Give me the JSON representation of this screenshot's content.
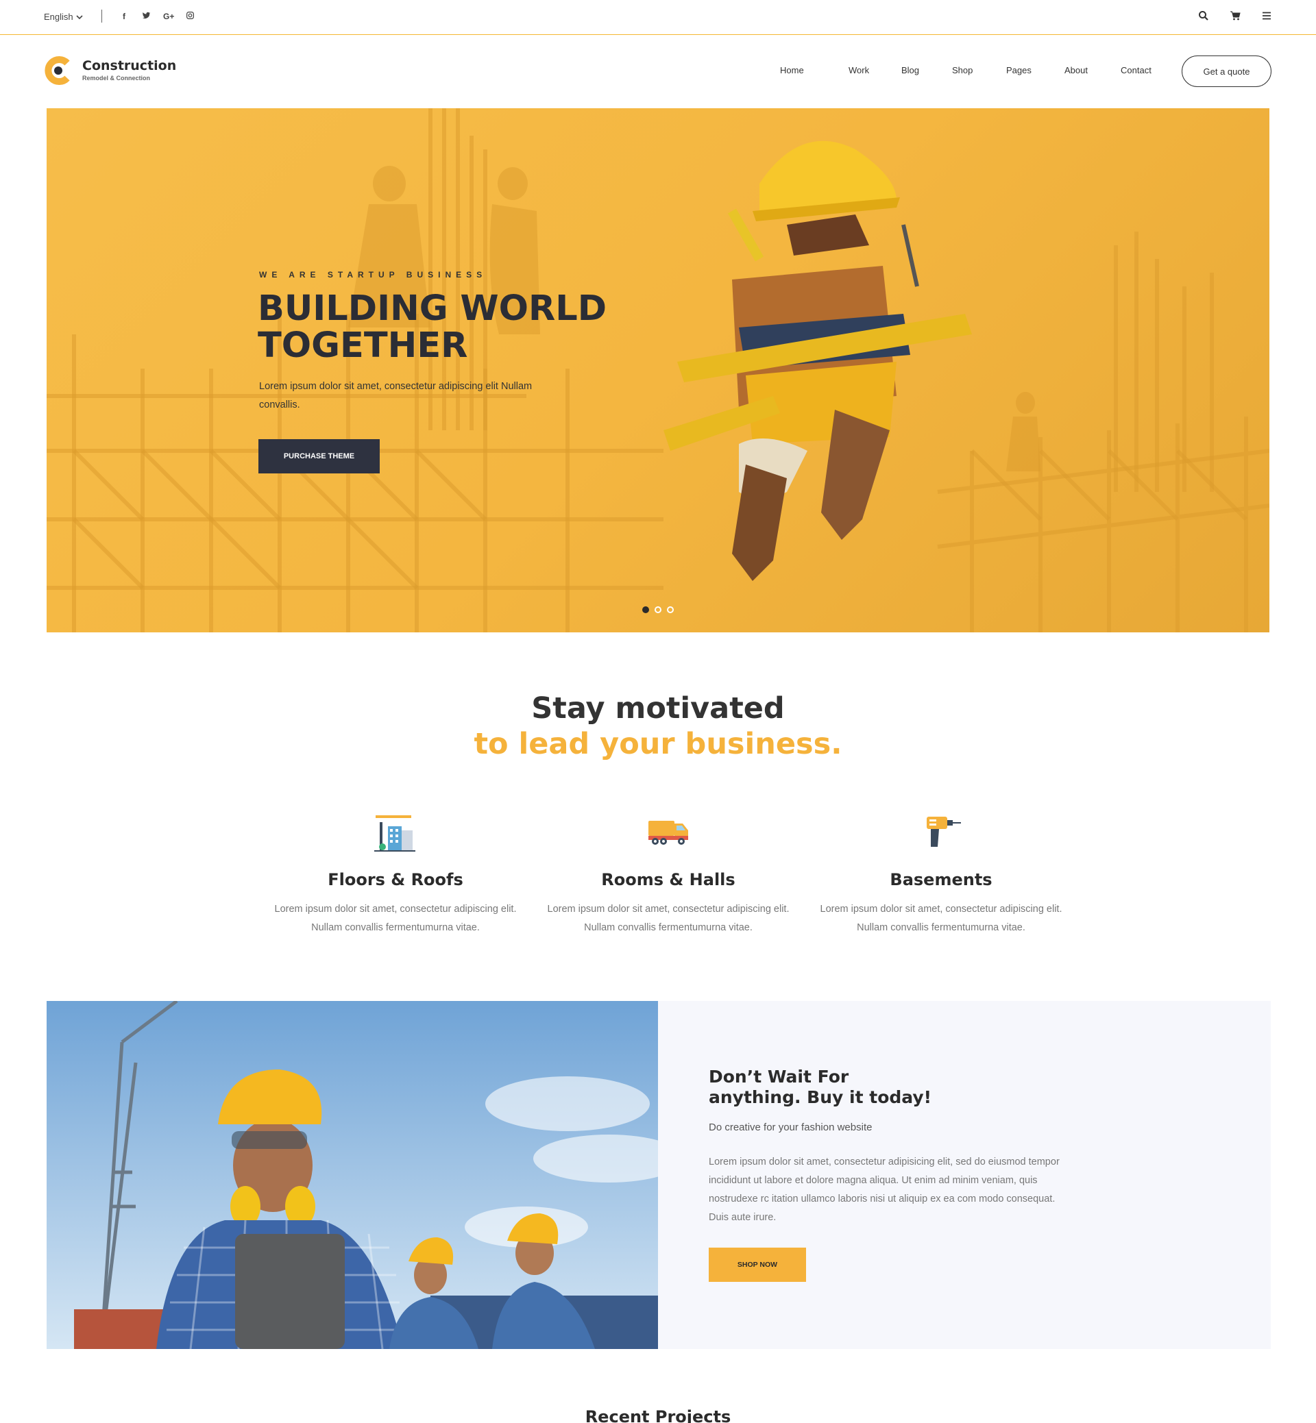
{
  "topbar": {
    "language": "English",
    "social": [
      {
        "icon": "facebook-icon",
        "glyph": "f"
      },
      {
        "icon": "twitter-icon",
        "glyph": "t"
      },
      {
        "icon": "google-plus-icon",
        "glyph": "G+"
      },
      {
        "icon": "instagram-icon",
        "glyph": "◎"
      }
    ],
    "right_icons": [
      "search-icon",
      "cart-icon",
      "menu-icon"
    ]
  },
  "header": {
    "logo_name": "Construction",
    "logo_tagline": "Remodel & Connection",
    "nav": [
      "Home",
      "Work",
      "Blog",
      "Shop",
      "Pages",
      "About",
      "Contact"
    ],
    "quote_label": "Get a quote"
  },
  "hero": {
    "subtitle": "WE ARE STARTUP BUSINESS",
    "title_line1": "BUILDING WORLD",
    "title_line2": "TOGETHER",
    "text": "Lorem ipsum dolor sit amet, consectetur adipiscing elit Nullam convallis.",
    "button_label": "PURCHASE THEME",
    "slides": 3,
    "active_slide": 1
  },
  "motivated": {
    "line1": "Stay motivated",
    "line2": "to lead your business."
  },
  "features": [
    {
      "icon": "building-crane-icon",
      "title": "Floors & Roofs",
      "text": "Lorem ipsum dolor sit amet, consectetur adipiscing elit. Nullam convallis fermentumurna vitae."
    },
    {
      "icon": "dump-truck-icon",
      "title": "Rooms & Halls",
      "text": "Lorem ipsum dolor sit amet, consectetur adipiscing elit. Nullam convallis fermentumurna vitae."
    },
    {
      "icon": "drill-icon",
      "title": "Basements",
      "text": "Lorem ipsum dolor sit amet, consectetur adipiscing elit. Nullam convallis fermentumurna vitae."
    }
  ],
  "promo": {
    "title_line1": "Don’t Wait For",
    "title_line2": "anything. Buy it today!",
    "subtitle": "Do creative for your fashion website",
    "text": "Lorem ipsum dolor sit amet, consectetur adipisicing elit, sed do eiusmod tempor incididunt ut labore et dolore magna aliqua. Ut enim ad minim veniam, quis nostrudexe rc itation ullamco laboris nisi ut aliquip ex ea com modo consequat. Duis aute irure.",
    "button_label": "SHOP NOW"
  },
  "recent_title": "Recent Projects",
  "colors": {
    "accent": "#f5b23b",
    "dark": "#2e3240",
    "hero_bg": "#f4b640",
    "promo_bg": "#f6f7fc"
  }
}
